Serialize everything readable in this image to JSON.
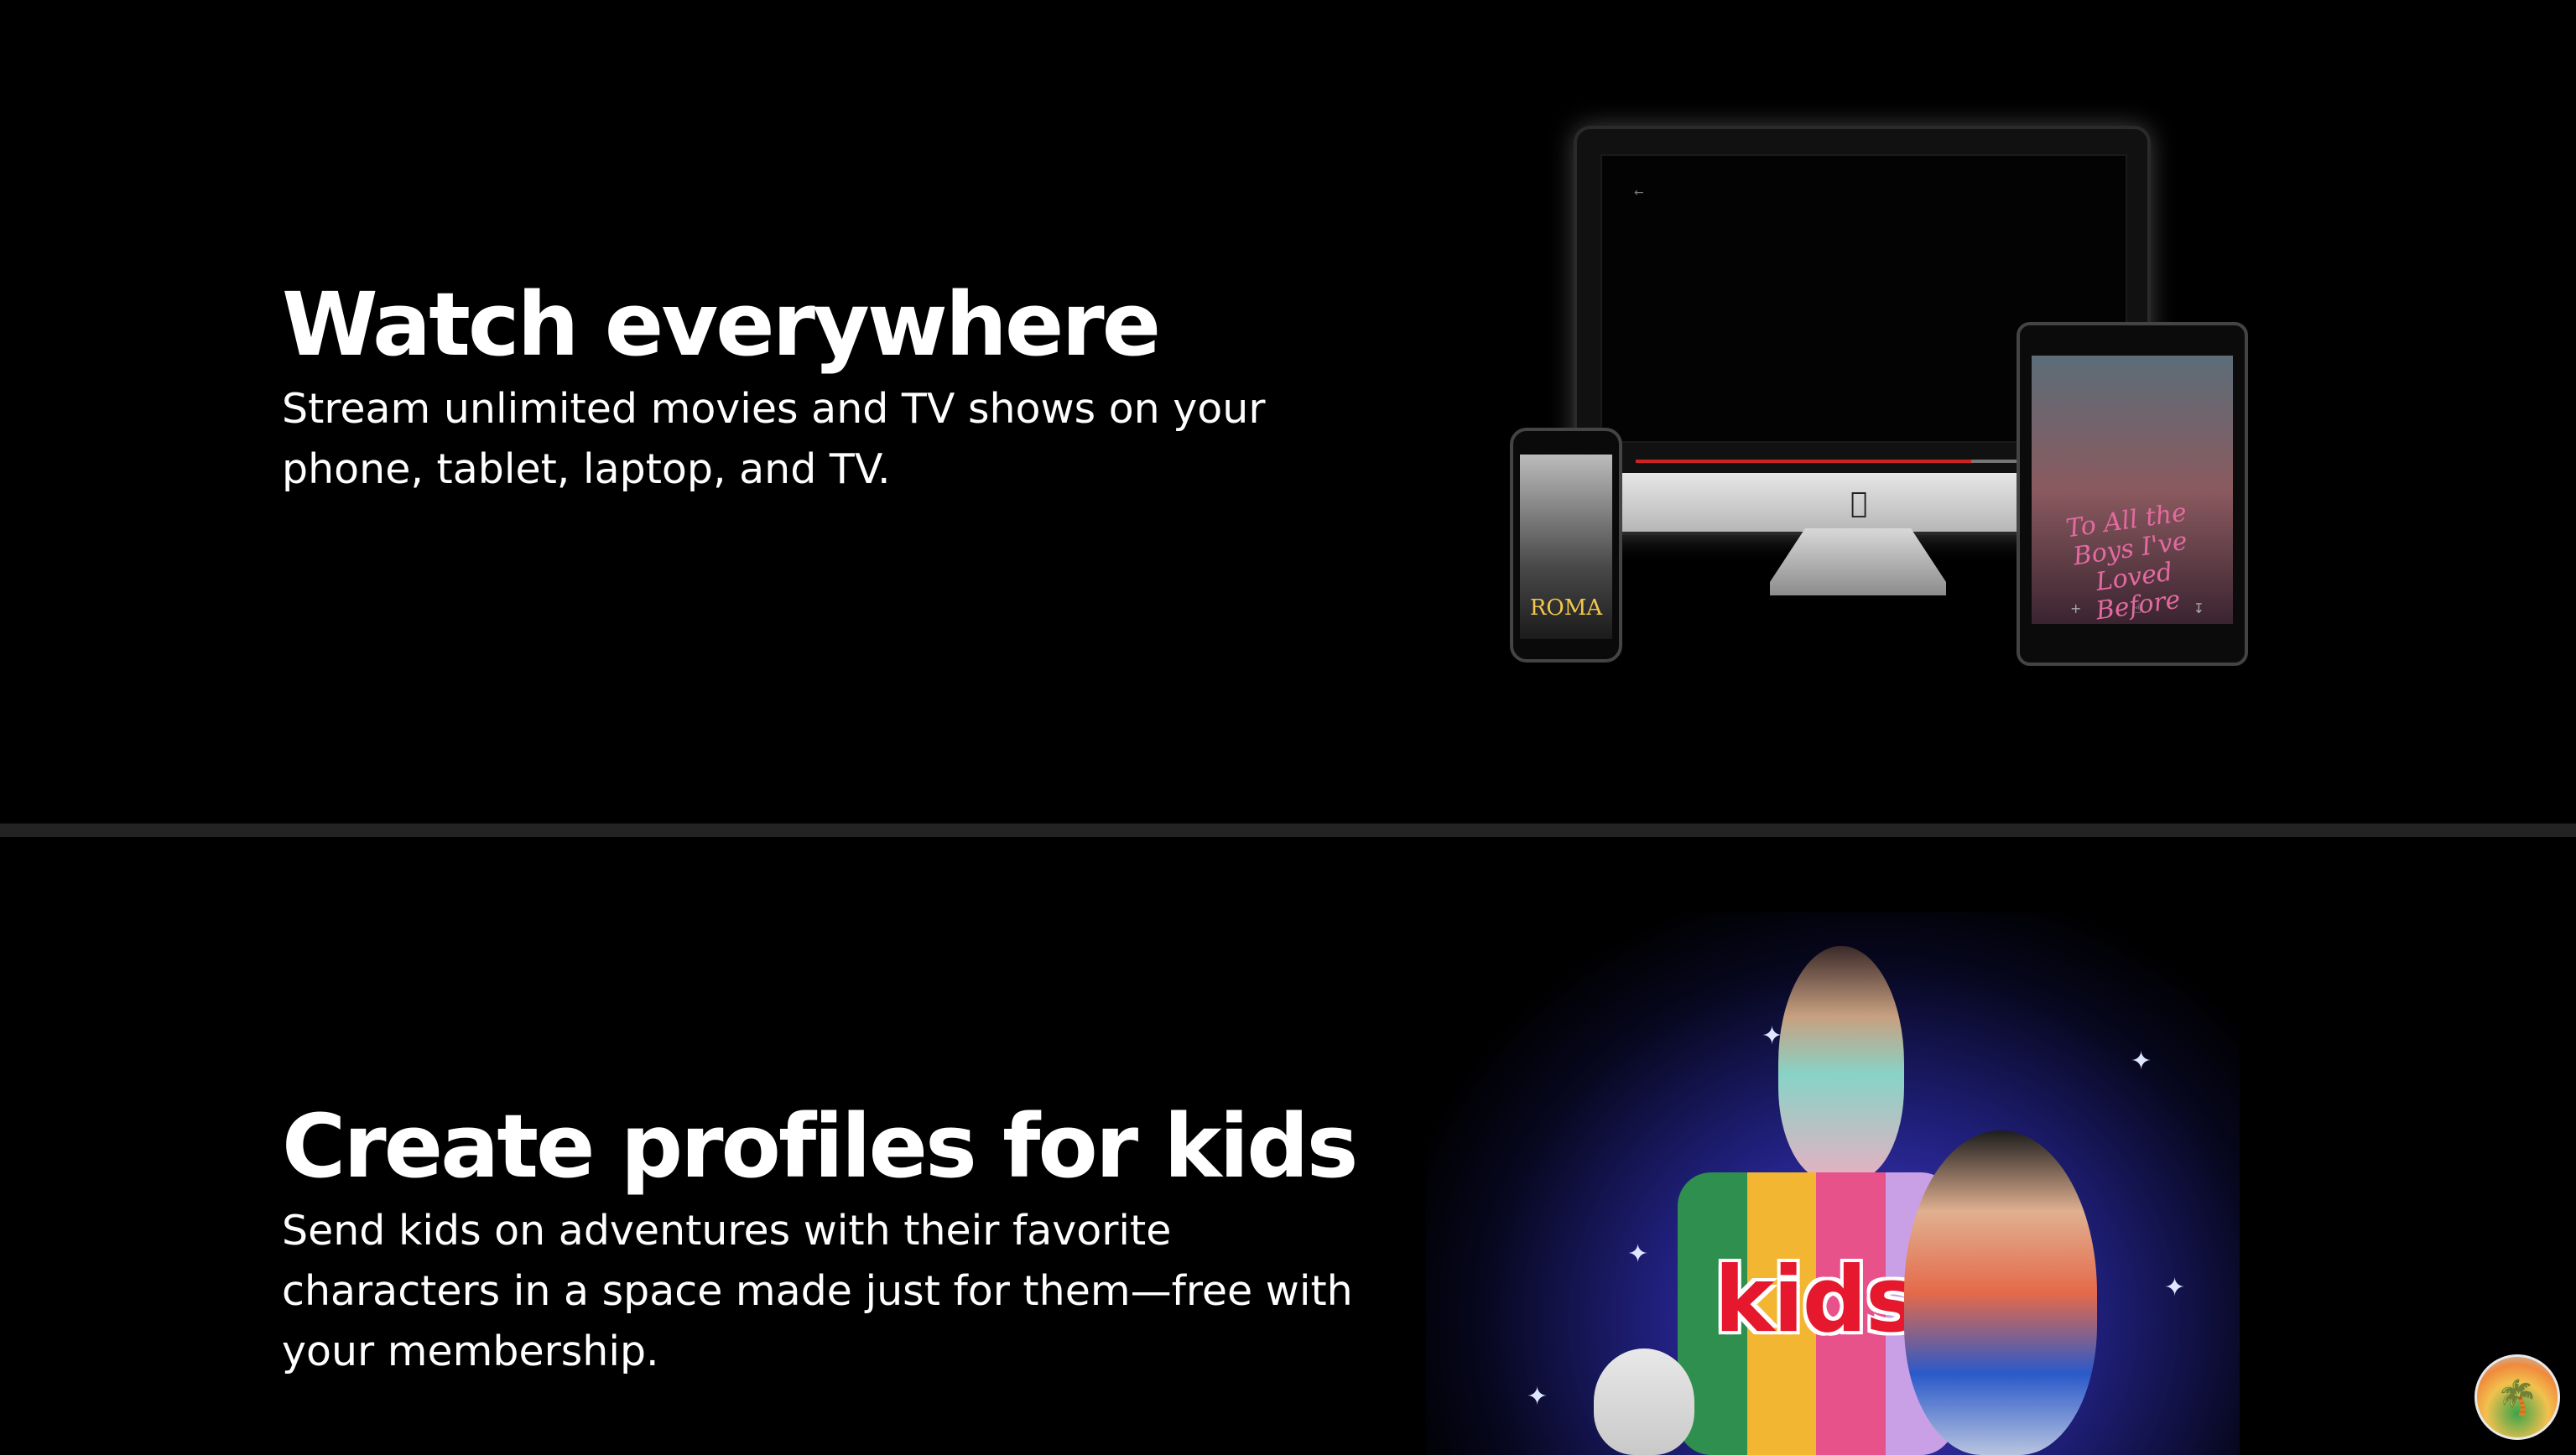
{
  "sections": [
    {
      "title": "Watch everywhere",
      "description_lines": [
        "Stream unlimited movies and TV shows on your",
        "phone, tablet, laptop, and TV."
      ],
      "devices": {
        "phone_title": "ROMA",
        "tablet_title": "To All the Boys I've Loved Before"
      }
    },
    {
      "title": "Create profiles for kids",
      "description_lines": [
        "Send kids on adventures with their favorite",
        "characters in a space made just for them—free with",
        "your membership."
      ],
      "kids_label": "kids"
    }
  ],
  "colors": {
    "background": "#000000",
    "divider": "#232323",
    "text": "#ffffff",
    "kids_red": "#e5182d",
    "kids_stripes": [
      "#2f8f4e",
      "#f2b632",
      "#e8528b",
      "#c9a0e6"
    ]
  },
  "icons": {
    "imac": "apple-logo-icon",
    "avatar": "palm-beach-avatar-icon"
  }
}
